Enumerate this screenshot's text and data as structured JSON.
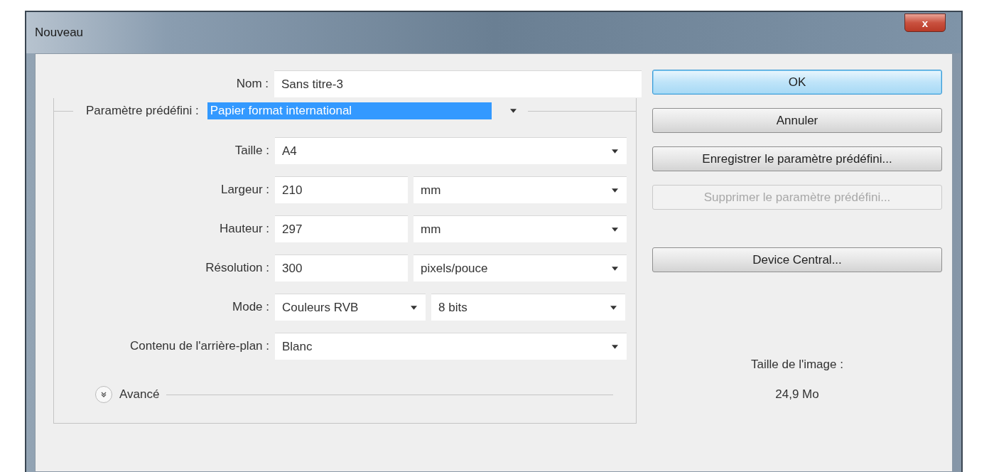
{
  "window": {
    "title": "Nouveau",
    "close_label": "x"
  },
  "name_field": {
    "label": "Nom :",
    "value": "Sans titre-3"
  },
  "preset": {
    "label": "Paramètre prédéfini :",
    "value": "Papier format international",
    "selected": true
  },
  "rows": [
    {
      "kind": "dropdown",
      "label": "Taille :",
      "value": "A4"
    },
    {
      "kind": "input_unit",
      "label": "Largeur :",
      "value": "210",
      "unit": "mm"
    },
    {
      "kind": "input_unit",
      "label": "Hauteur :",
      "value": "297",
      "unit": "mm"
    },
    {
      "kind": "input_unit",
      "label": "Résolution :",
      "value": "300",
      "unit": "pixels/pouce"
    },
    {
      "kind": "two_dropdowns",
      "label": "Mode :",
      "value": "Couleurs RVB",
      "unit": "8 bits"
    },
    {
      "kind": "dropdown",
      "label": "Contenu de l'arrière-plan :",
      "value": "Blanc"
    }
  ],
  "advanced": {
    "label": "Avancé",
    "expanded": false
  },
  "buttons": [
    {
      "label": "OK",
      "default": true,
      "disabled": false
    },
    {
      "label": "Annuler",
      "default": false,
      "disabled": false
    },
    {
      "label": "Enregistrer le paramètre prédéfini...",
      "default": false,
      "disabled": false
    },
    {
      "label": "Supprimer le paramètre prédéfini...",
      "default": false,
      "disabled": true
    },
    {
      "label": "Device Central...",
      "default": false,
      "disabled": false
    }
  ],
  "image_size": {
    "label": "Taille de l'image :",
    "value": "24,9 Mo"
  }
}
